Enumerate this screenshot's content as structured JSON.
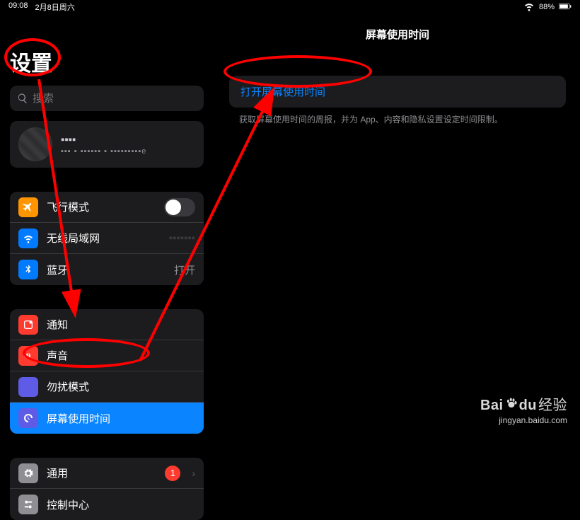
{
  "status": {
    "time": "09:08",
    "date": "2月8日周六",
    "battery": "88%"
  },
  "sidebar": {
    "title": "设置",
    "search_placeholder": "搜索",
    "account": {
      "name": "▪▪▪▪",
      "sub": "▪▪▪ ▪ ▪▪▪▪▪▪ ▪ ▪▪▪▪▪▪▪▪▪e"
    },
    "group1": [
      {
        "label": "飞行模式",
        "type": "toggle"
      },
      {
        "label": "无线局域网",
        "value": "▪▪▪▪▪▪▪"
      },
      {
        "label": "蓝牙",
        "value": "打开"
      }
    ],
    "group2": [
      {
        "label": "通知"
      },
      {
        "label": "声音"
      },
      {
        "label": "勿扰模式"
      },
      {
        "label": "屏幕使用时间",
        "active": true
      }
    ],
    "group3": [
      {
        "label": "通用",
        "badge": "1"
      },
      {
        "label": "控制中心"
      }
    ]
  },
  "detail": {
    "title": "屏幕使用时间",
    "action": "打开屏幕使用时间",
    "hint": "获取屏幕使用时间的周报，并为 App、内容和隐私设置设定时间限制。"
  },
  "watermark": {
    "logo_pre": "Bai",
    "logo_mid": "du",
    "logo_suf": "经验",
    "url": "jingyan.baidu.com"
  }
}
